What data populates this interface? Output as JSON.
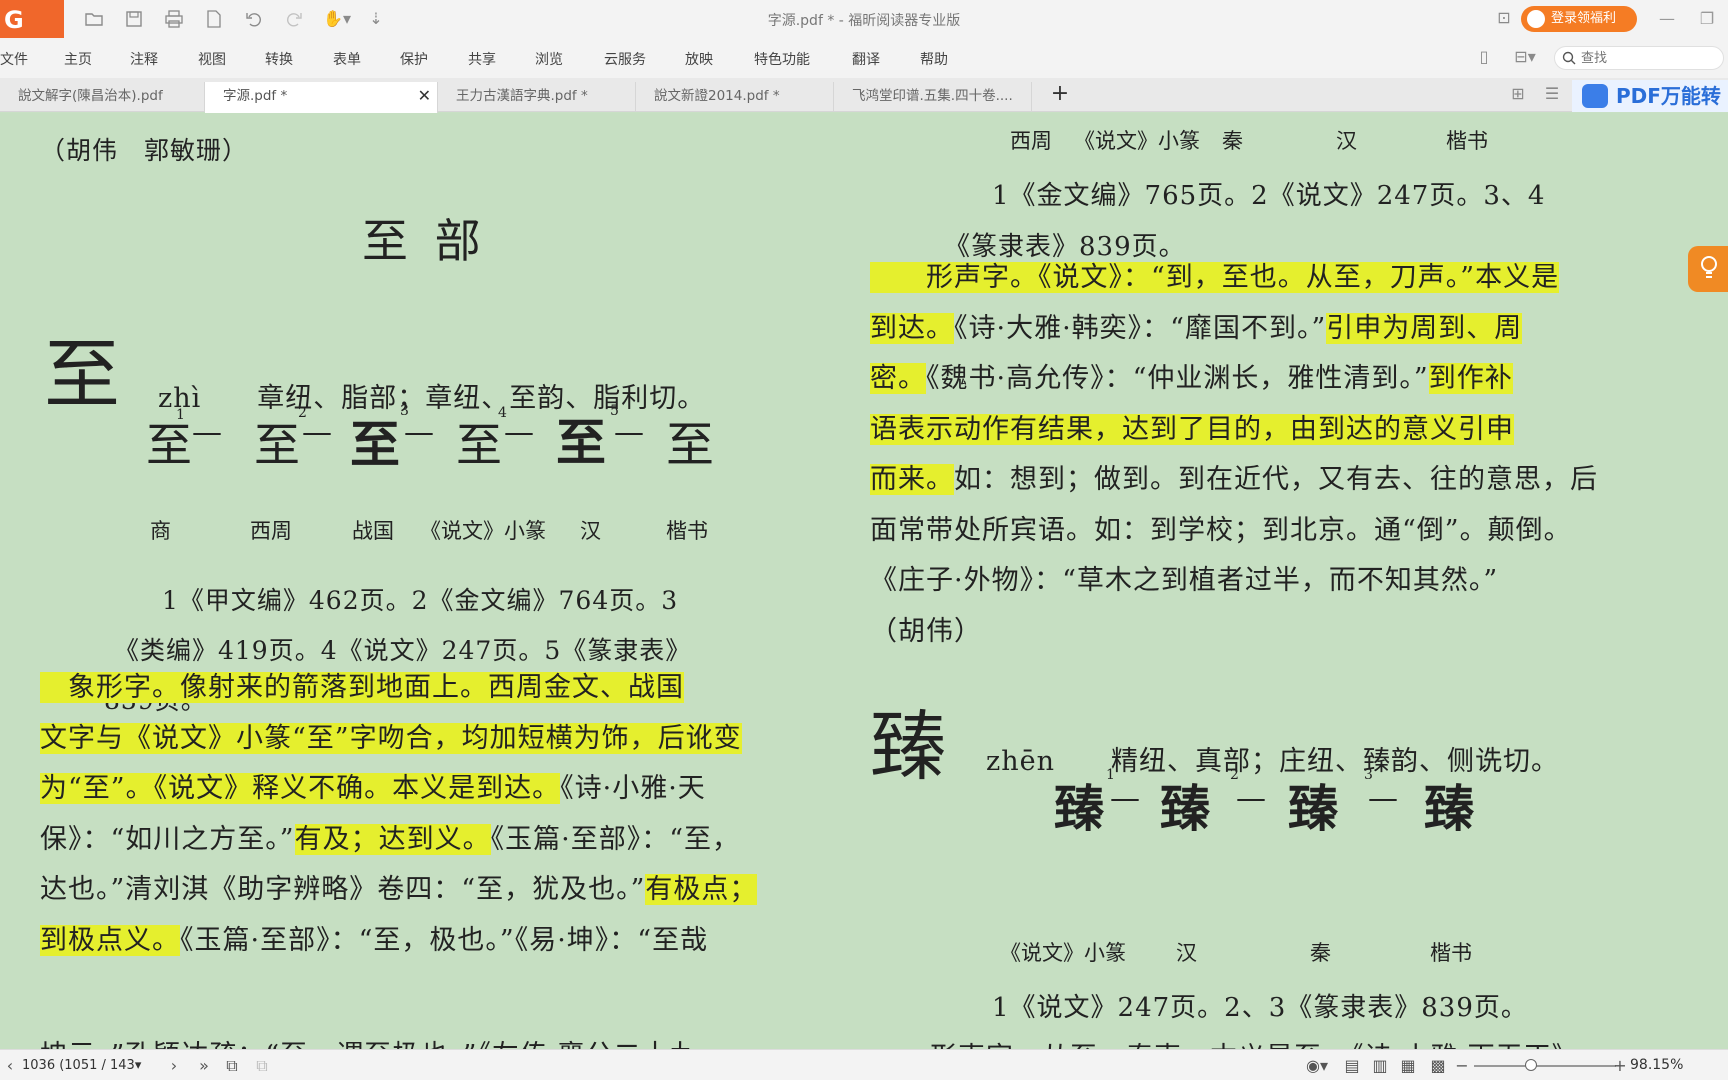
{
  "window": {
    "title": "字源.pdf * - 福昕阅读器专业版",
    "login_label": "登录领福利"
  },
  "menu": {
    "items": [
      "文件",
      "主页",
      "注释",
      "视图",
      "转换",
      "表单",
      "保护",
      "共享",
      "浏览",
      "云服务",
      "放映",
      "特色功能",
      "翻译",
      "帮助"
    ],
    "search_placeholder": "查找"
  },
  "tabs": [
    {
      "label": "說文解字(陳昌治本).pdf",
      "active": false
    },
    {
      "label": "字源.pdf *",
      "active": true
    },
    {
      "label": "王力古漢語字典.pdf *",
      "active": false
    },
    {
      "label": "說文新證2014.pdf *",
      "active": false
    },
    {
      "label": "飞鸿堂印谱.五集.四十卷....",
      "active": false
    }
  ],
  "pdf_banner": "PDF万能转",
  "left_page": {
    "authors": "（胡伟　郭敏珊）",
    "section_title": "至 部",
    "entry_char": "至",
    "entry_reading": "zhì　　章纽、脂部；章纽、至韵、脂利切。",
    "evolution_glyphs": [
      "至",
      "至",
      "至",
      "至",
      "至",
      "至"
    ],
    "evolution_numbers": [
      "1",
      "2",
      "3",
      "4",
      "5"
    ],
    "evolution_labels": [
      "商",
      "西周",
      "战国",
      "《说文》小篆",
      "汉",
      "楷书"
    ],
    "refs": [
      "1《甲文编》462页。2《金文编》764页。3",
      "《类编》419页。4《说文》247页。5《篆隶表》",
      "839页。"
    ],
    "body": [
      {
        "segments": [
          {
            "t": "　象形字。像射来的箭落到地面上。",
            "h": true
          },
          {
            "t": "西周金文、战国",
            "h": true
          }
        ]
      },
      {
        "segments": [
          {
            "t": "文字与《说文》小篆“至”字吻合，均加短横为饰，后讹变",
            "h": true
          }
        ]
      },
      {
        "segments": [
          {
            "t": "为“至”。《说文》释义不确。本义是到达。",
            "h": true
          },
          {
            "t": "《诗·小雅·天",
            "h": false
          }
        ]
      },
      {
        "segments": [
          {
            "t": "保》：“如川之方至。”",
            "h": false
          },
          {
            "t": "有及；达到义。",
            "h": true
          },
          {
            "t": "《玉篇·至部》：“至，",
            "h": false
          }
        ]
      },
      {
        "segments": [
          {
            "t": "达也。”清刘淇《助字辨略》卷四：“至，犹及也。”",
            "h": false
          },
          {
            "t": "有极点；",
            "h": true
          }
        ]
      },
      {
        "segments": [
          {
            "t": "到极点义。",
            "h": true
          },
          {
            "t": "《玉篇·至部》：“至，极也。”《易·坤》：“至哉",
            "h": false
          }
        ]
      }
    ],
    "cut_line": "坤元。”孔颖达疏：“至，谓至极也。”《左传·襄公二十九"
  },
  "right_page": {
    "top_labels": [
      "西周",
      "《说文》小篆",
      "秦",
      "汉",
      "楷书"
    ],
    "refs": [
      "1《金文编》765页。2《说文》247页。3、4",
      "《篆隶表》839页。"
    ],
    "body": [
      {
        "segments": [
          {
            "t": "　　形声字。《说文》：“到，至也。从至，刀声。”本义是",
            "h": true
          }
        ]
      },
      {
        "segments": [
          {
            "t": "到达。",
            "h": true
          },
          {
            "t": "《诗·大雅·韩奕》：“靡国不到。”",
            "h": false
          },
          {
            "t": "引申为周到、周",
            "h": true
          }
        ]
      },
      {
        "segments": [
          {
            "t": "密。",
            "h": true
          },
          {
            "t": "《魏书·高允传》：“仲业渊长，雅性清到。”",
            "h": false
          },
          {
            "t": "到作补",
            "h": true
          }
        ]
      },
      {
        "segments": [
          {
            "t": "语表示动作有结果，达到了目的，由到达的意义引申",
            "h": true
          }
        ]
      },
      {
        "segments": [
          {
            "t": "而来。",
            "h": true
          },
          {
            "t": "如：想到；做到。到在近代，又有去、往的意思，后",
            "h": false
          }
        ]
      },
      {
        "segments": [
          {
            "t": "面常带处所宾语。如：到学校；到北京。通“倒”。颠倒。",
            "h": false
          }
        ]
      },
      {
        "segments": [
          {
            "t": "《庄子·外物》：“草木之到植者过半，而不知其然。”",
            "h": false
          }
        ]
      },
      {
        "segments": [
          {
            "t": "（胡伟）",
            "h": false
          }
        ]
      }
    ],
    "entry2_char": "臻",
    "entry2_reading": "zhēn　　精纽、真部；庄纽、臻韵、侧诜切。",
    "evolution2_glyphs": [
      "臻",
      "臻",
      "臻",
      "臻"
    ],
    "evolution2_numbers": [
      "1",
      "2",
      "3"
    ],
    "evolution2_labels": [
      "《说文》小篆",
      "汉",
      "秦",
      "楷书"
    ],
    "refs2": "1《说文》247页。2、3《篆隶表》839页。",
    "cut_line": "形声字。从至，秦声。本义是至。《诗·小雅·雨无正》"
  },
  "status": {
    "page_display": "1036 (1051 / 143",
    "zoom": "98.15%",
    "zoom_fraction": 0.4
  },
  "colors": {
    "page_bg": "#c6dfc2",
    "highlight": "#e5ef2e",
    "brand_orange": "#f0672b",
    "pdf_blue": "#3b7ee8"
  }
}
